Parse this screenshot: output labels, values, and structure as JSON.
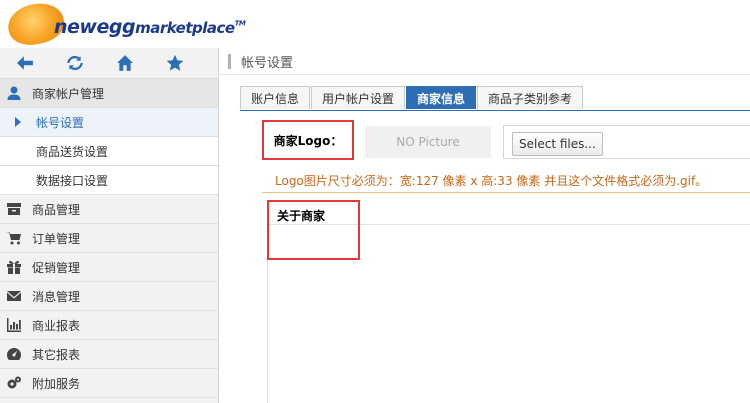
{
  "brand": {
    "name_main": "newegg",
    "name_sub": "marketplace",
    "trademark": "TM"
  },
  "toolbar": {
    "back_icon": "arrow-left-icon",
    "refresh_icon": "refresh-icon",
    "home_icon": "home-icon",
    "favorite_icon": "star-icon"
  },
  "sidebar": {
    "group": {
      "label": "商家帐户管理",
      "icon": "user-icon"
    },
    "sub_items": [
      {
        "label": "帐号设置",
        "active": true
      },
      {
        "label": "商品送货设置"
      },
      {
        "label": "数据接口设置"
      }
    ],
    "items": [
      {
        "label": "商品管理",
        "icon": "archive-icon"
      },
      {
        "label": "订单管理",
        "icon": "cart-icon"
      },
      {
        "label": "促销管理",
        "icon": "gift-icon"
      },
      {
        "label": "消息管理",
        "icon": "envelope-icon"
      },
      {
        "label": "商业报表",
        "icon": "bar-chart-icon"
      },
      {
        "label": "其它报表",
        "icon": "dashboard-icon"
      },
      {
        "label": "附加服务",
        "icon": "gears-icon"
      }
    ]
  },
  "breadcrumb": {
    "title": "帐号设置"
  },
  "tabs": [
    {
      "label": "账户信息"
    },
    {
      "label": "用户帐户设置"
    },
    {
      "label": "商家信息",
      "active": true
    },
    {
      "label": "商品子类别参考"
    }
  ],
  "form": {
    "logo_label": "商家Logo：",
    "no_picture": "NO Picture",
    "select_files": "Select files...",
    "hint": "Logo图片尺寸必须为：宽:127 像素 x 高:33 像素 并且这个文件格式必须为.gif。",
    "about_label": "关于商家"
  },
  "colors": {
    "accent": "#2d6db3",
    "highlight_border": "#e53935",
    "hint": "#c8661a"
  }
}
